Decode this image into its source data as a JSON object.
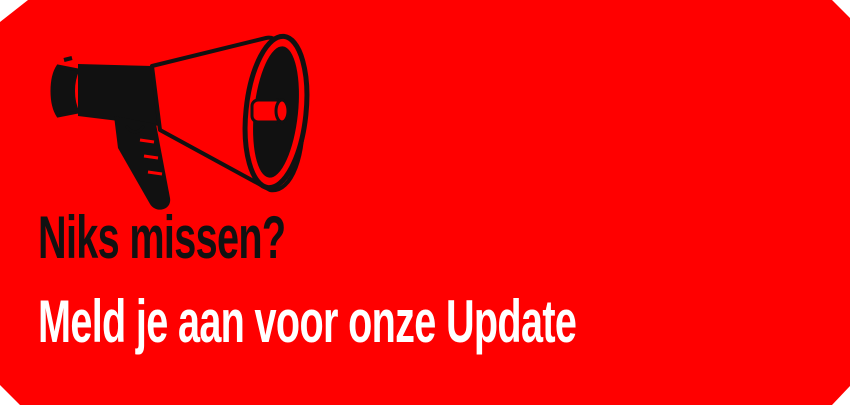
{
  "banner": {
    "headline": "Niks missen?",
    "subline": "Meld je aan voor onze Update",
    "icon": "megaphone-icon",
    "colors": {
      "background": "#ff0000",
      "headline": "#111111",
      "subline": "#ffffff",
      "icon_outline": "#111111"
    }
  }
}
